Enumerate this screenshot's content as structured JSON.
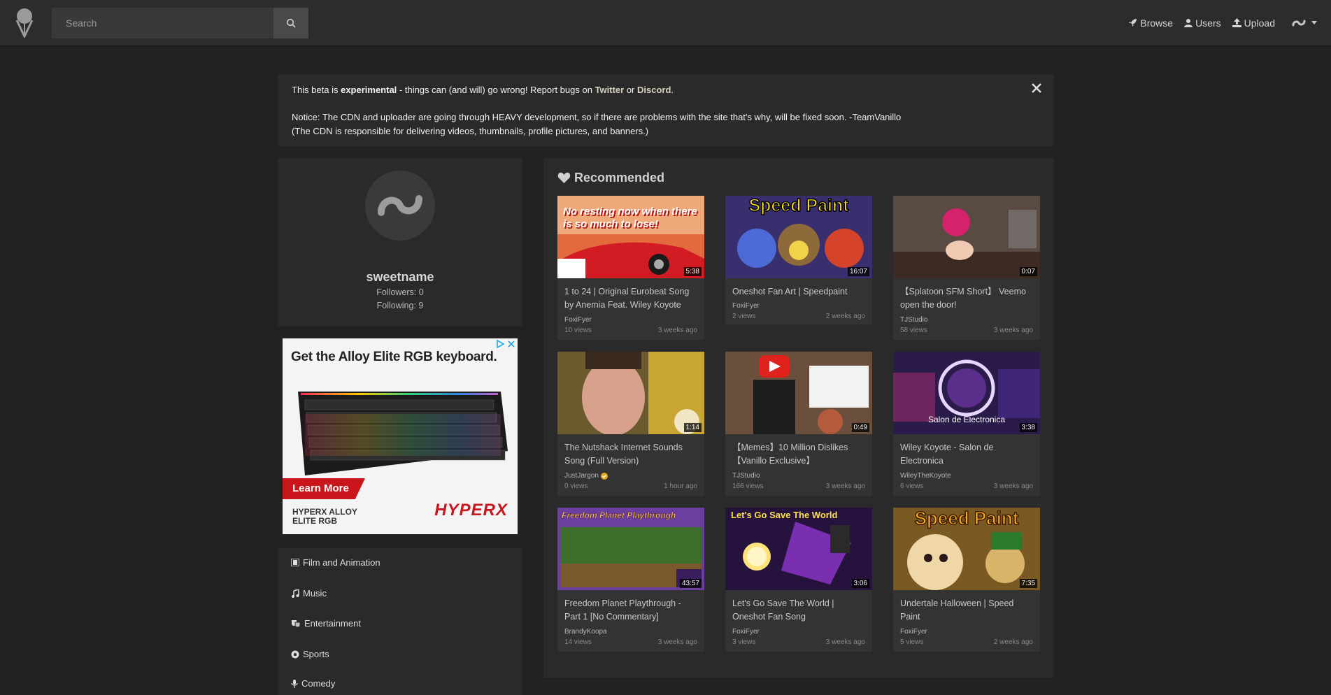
{
  "nav": {
    "search_placeholder": "Search",
    "browse": "Browse",
    "users": "Users",
    "upload": "Upload"
  },
  "notice": {
    "line1_pre": "This beta is ",
    "line1_bold": "experimental",
    "line1_mid": " - things can (and will) go wrong! Report bugs on ",
    "twitter": "Twitter",
    "or": " or ",
    "discord": "Discord",
    "period": ".",
    "line2": "Notice: The CDN and uploader are going through HEAVY development, so if there are problems with the site that's why, will be fixed soon. -TeamVanillo",
    "line3": "(The CDN is responsible for delivering videos, thumbnails, profile pictures, and banners.)"
  },
  "profile": {
    "username": "sweetname",
    "followers": "Followers: 0",
    "following": "Following: 9"
  },
  "ad": {
    "headline": "Get the Alloy Elite RGB keyboard.",
    "cta": "Learn More",
    "product_line1": "HYPERX ALLOY",
    "product_line2": "ELITE RGB",
    "brand": "HYPERX"
  },
  "categories": [
    {
      "label": "Film and Animation",
      "icon": "film-icon"
    },
    {
      "label": "Music",
      "icon": "music-icon"
    },
    {
      "label": "Entertainment",
      "icon": "theater-masks-icon"
    },
    {
      "label": "Sports",
      "icon": "soccer-ball-icon"
    },
    {
      "label": "Comedy",
      "icon": "microphone-icon"
    }
  ],
  "recommended": {
    "title": "Recommended",
    "videos": [
      {
        "title": "1 to 24 | Original Eurobeat Song by Anemia Feat. Wiley Koyote",
        "author": "FoxiFyer",
        "views": "10 views",
        "date": "3 weeks ago",
        "duration": "5:38",
        "thumb_text": "No resting now when there is so much to lose!"
      },
      {
        "title": "Oneshot Fan Art | Speedpaint",
        "author": "FoxiFyer",
        "views": "2 views",
        "date": "2 weeks ago",
        "duration": "16:07",
        "thumb_text": "Speed Paint"
      },
      {
        "title": "【Splatoon SFM Short】 Veemo open the door!",
        "author": "TJStudio",
        "views": "58 views",
        "date": "3 weeks ago",
        "duration": "0:07",
        "thumb_text": ""
      },
      {
        "title": "The Nutshack Internet Sounds Song (Full Version)",
        "author": "JustJargon",
        "views": "0 views",
        "date": "1 hour ago",
        "duration": "1:14",
        "thumb_text": "",
        "verified": true
      },
      {
        "title": "【Memes】10 Million Dislikes 【Vanillo Exclusive】",
        "author": "TJStudio",
        "views": "166 views",
        "date": "3 weeks ago",
        "duration": "0:49",
        "thumb_text": ""
      },
      {
        "title": "Wiley Koyote - Salon de Electronica",
        "author": "WileyTheKoyote",
        "views": "6 views",
        "date": "3 weeks ago",
        "duration": "3:38",
        "thumb_text": "Salon de Electronica"
      },
      {
        "title": "Freedom Planet Playthrough - Part 1 [No Commentary]",
        "author": "BrandyKoopa",
        "views": "14 views",
        "date": "3 weeks ago",
        "duration": "43:57",
        "thumb_text": "Freedom Planet Playthrough"
      },
      {
        "title": "Let's Go Save The World | Oneshot Fan Song",
        "author": "FoxiFyer",
        "views": "3 views",
        "date": "3 weeks ago",
        "duration": "3:06",
        "thumb_text": "Let's Go Save The World"
      },
      {
        "title": "Undertale Halloween | Speed Paint",
        "author": "FoxiFyer",
        "views": "5 views",
        "date": "2 weeks ago",
        "duration": "7:35",
        "thumb_text": "Speed Paint"
      }
    ]
  }
}
